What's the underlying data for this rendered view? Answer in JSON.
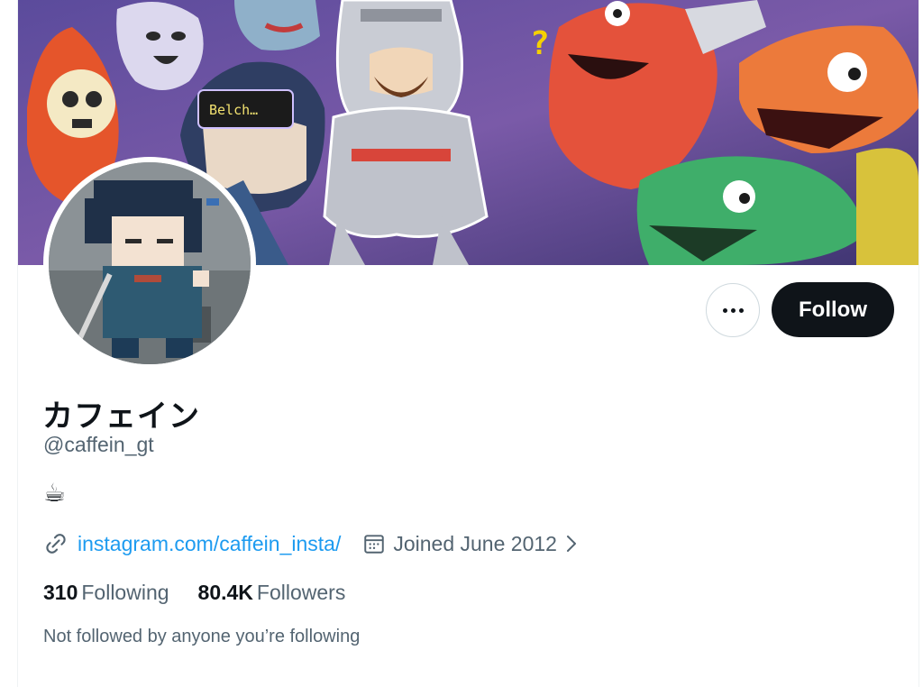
{
  "profile": {
    "display_name": "カフェイン",
    "handle": "@caffein_gt",
    "bio": "☕",
    "website": "instagram.com/caffein_insta/",
    "joined": "Joined June 2012"
  },
  "banner": {
    "speech_text": "Belch…"
  },
  "actions": {
    "follow_label": "Follow",
    "more_icon": "more-horizontal-icon"
  },
  "stats": {
    "following_count": "310",
    "following_label": "Following",
    "followers_count": "80.4K",
    "followers_label": "Followers"
  },
  "social_context": "Not followed by anyone you’re following",
  "icons": {
    "website": "link-icon",
    "joined": "calendar-icon",
    "expand": "chevron-right-icon"
  },
  "colors": {
    "link": "#1d9bf0",
    "secondary_text": "#536471",
    "follow_button": "#0f1419"
  }
}
